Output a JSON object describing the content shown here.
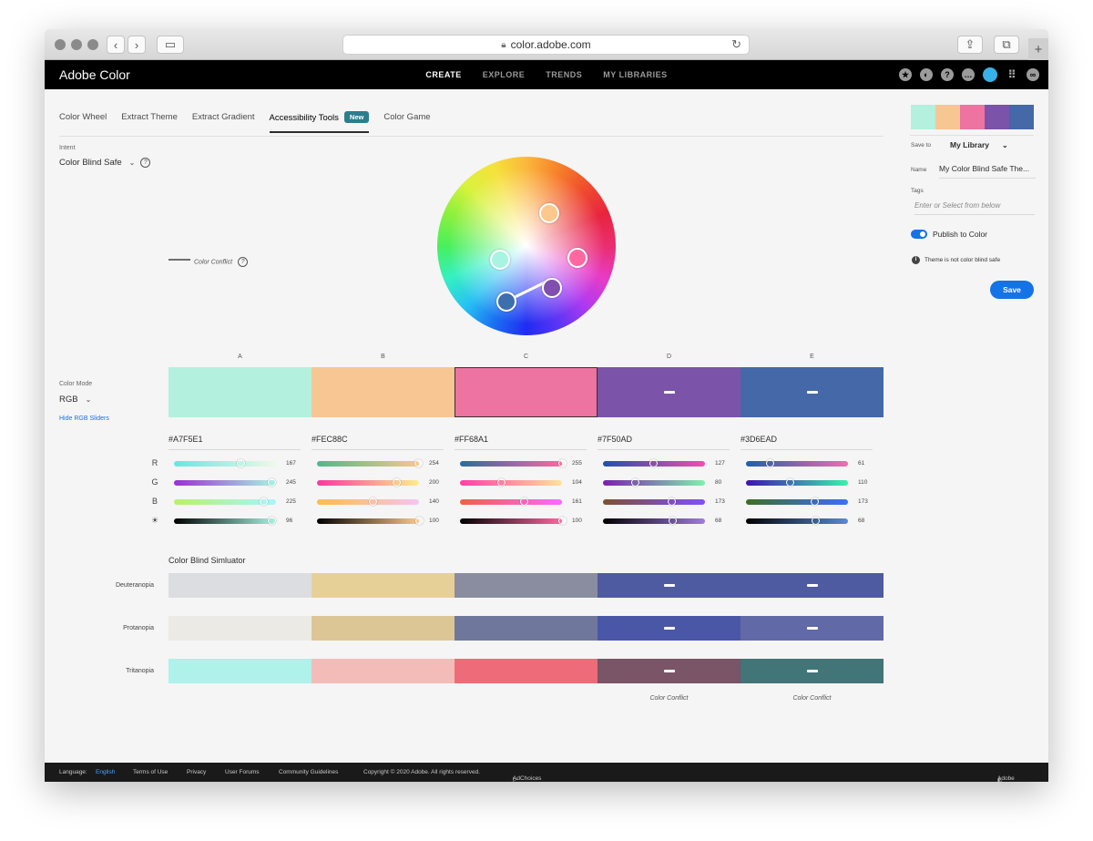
{
  "browser": {
    "url": "color.adobe.com",
    "new_tab": "+"
  },
  "app": {
    "brand": "Adobe Color",
    "nav": [
      "CREATE",
      "EXPLORE",
      "TRENDS",
      "MY LIBRARIES"
    ]
  },
  "tabs": [
    "Color Wheel",
    "Extract Theme",
    "Extract Gradient",
    "Accessibility Tools",
    "Color Game"
  ],
  "new_badge": "New",
  "intent": {
    "label": "Intent",
    "value": "Color Blind Safe"
  },
  "legend": {
    "conflict": "Color Conflict"
  },
  "color_mode": {
    "label": "Color Mode",
    "value": "RGB",
    "toggle_link": "Hide RGB Sliders"
  },
  "swatches": [
    {
      "letter": "A",
      "hex": "#A7F5E1",
      "color": "#b3f0dd",
      "rgb": [
        167,
        245,
        225,
        96
      ]
    },
    {
      "letter": "B",
      "hex": "#FEC88C",
      "color": "#f7c692",
      "rgb": [
        254,
        200,
        140,
        100
      ]
    },
    {
      "letter": "C",
      "hex": "#FF68A1",
      "color": "#ed74a1",
      "rgb": [
        255,
        104,
        161,
        100
      ]
    },
    {
      "letter": "D",
      "hex": "#7F50AD",
      "color": "#7b53a9",
      "rgb": [
        127,
        80,
        173,
        68
      ]
    },
    {
      "letter": "E",
      "hex": "#3D6EAD",
      "color": "#4468a8",
      "rgb": [
        61,
        110,
        173,
        68
      ]
    }
  ],
  "channels": [
    "R",
    "G",
    "B",
    "☀"
  ],
  "simulator": {
    "title": "Color Blind Simluator",
    "rows": [
      {
        "name": "Deuteranopia",
        "colors": [
          "#dcdde1",
          "#e6d098",
          "#8a8d9f",
          "#4f5ba0",
          "#4f5ba0"
        ]
      },
      {
        "name": "Protanopia",
        "colors": [
          "#eceae4",
          "#ddc695",
          "#70779c",
          "#4a57a6",
          "#6169a7"
        ]
      },
      {
        "name": "Tritanopia",
        "colors": [
          "#aef2ea",
          "#f3bcb8",
          "#ee6c7a",
          "#7a5467",
          "#427577"
        ]
      }
    ],
    "conflict_notes": [
      "Color Conflict",
      "Color Conflict"
    ]
  },
  "panel": {
    "save_to_label": "Save to",
    "save_to_value": "My Library",
    "name_label": "Name",
    "name_value": "My Color Blind Safe The...",
    "tags_label": "Tags",
    "tags_placeholder": "Enter or Select from below",
    "publish_label": "Publish to Color",
    "warning": "Theme is not color blind safe",
    "save_button": "Save"
  },
  "footer": {
    "language_label": "Language:",
    "language_value": "English",
    "links": [
      "Terms of Use",
      "Privacy",
      "User Forums",
      "Community Guidelines"
    ],
    "copyright": "Copyright © 2020 Adobe. All rights reserved.",
    "adchoices": "AdChoices",
    "adobe": "Adobe"
  }
}
